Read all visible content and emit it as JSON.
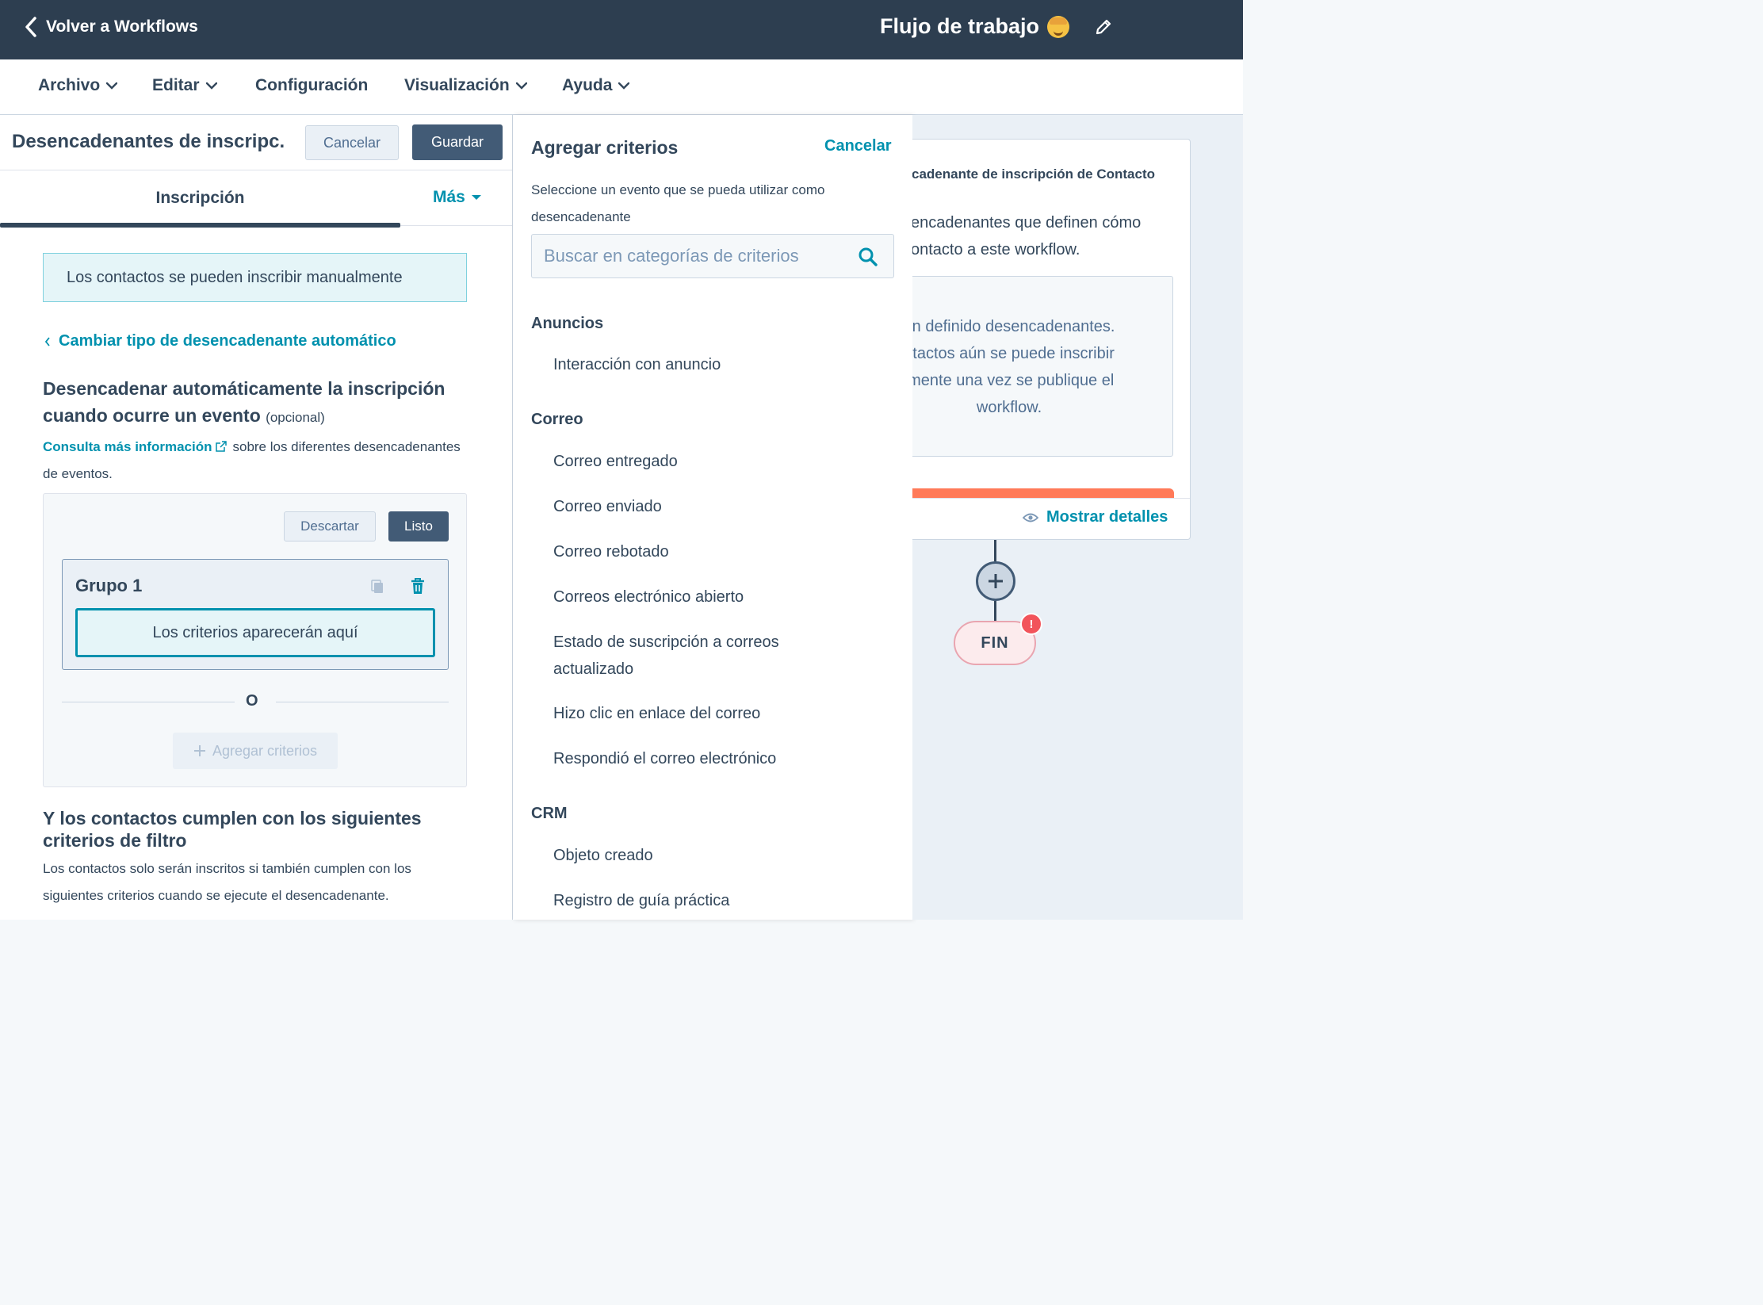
{
  "topbar": {
    "back_label": "Volver a Workflows",
    "workflow_title": "Flujo de trabajo"
  },
  "menubar": {
    "items": [
      {
        "label": "Archivo",
        "has_dropdown": true
      },
      {
        "label": "Editar",
        "has_dropdown": true
      },
      {
        "label": "Configuración",
        "has_dropdown": false
      },
      {
        "label": "Visualización",
        "has_dropdown": true
      },
      {
        "label": "Ayuda",
        "has_dropdown": true
      }
    ]
  },
  "left_panel": {
    "title": "Desencadenantes de inscripc...",
    "cancel_label": "Cancelar",
    "save_label": "Guardar",
    "tab_inscripcion": "Inscripción",
    "tab_mas": "Más",
    "manual_enroll_text": "Los contactos se pueden inscribir manualmente",
    "change_trigger_link": "Cambiar tipo de desencadenante automático",
    "auto_heading_line1": "Desencadenar automáticamente la inscripción",
    "auto_heading_line2": "cuando ocurre un evento",
    "optional_label": "(opcional)",
    "info_link": "Consulta más información",
    "info_text": "sobre los diferentes desencadenantes de eventos.",
    "discard_label": "Descartar",
    "done_label": "Listo",
    "group_title": "Grupo 1",
    "criteria_placeholder": "Los criterios aparecerán aquí",
    "or_label": "O",
    "add_criteria_label": "Agregar criterios",
    "filter_heading": "Y los contactos cumplen con los siguientes criterios de filtro",
    "filter_text": "Los contactos solo serán inscritos si también cumplen con los siguientes criterios cuando se ejecute el desencadenante."
  },
  "mid_panel": {
    "title": "Agregar criterios",
    "cancel_label": "Cancelar",
    "description": "Seleccione un evento que se pueda utilizar como desencadenante",
    "search_placeholder": "Buscar en categorías de criterios",
    "categories": [
      {
        "heading": "Anuncios",
        "items": [
          "Interacción con anuncio"
        ]
      },
      {
        "heading": "Correo",
        "items": [
          "Correo entregado",
          "Correo enviado",
          "Correo rebotado",
          "Correos electrónico abierto",
          "Estado de suscripción a correos actualizado",
          "Hizo clic en enlace del correo",
          "Respondió el correo electrónico"
        ]
      },
      {
        "heading": "CRM",
        "items": [
          "Objeto creado",
          "Registro de guía práctica"
        ]
      }
    ]
  },
  "canvas": {
    "card_title": "cadenante de inscripción de Contacto",
    "card_desc": "encadenantes que definen cómo ontacto a este workflow.",
    "card_inner_text": "an definido desencadenantes. ntactos aún se puede inscribir lmente una vez se publique el workflow.",
    "show_details": "Mostrar detalles",
    "end_label": "FIN",
    "alert_label": "!"
  },
  "colors": {
    "topbar": "#2d3e50",
    "link": "#0091ae",
    "primary_button": "#425b76",
    "accent_orange": "#ff7a59",
    "alert": "#f2545b"
  }
}
